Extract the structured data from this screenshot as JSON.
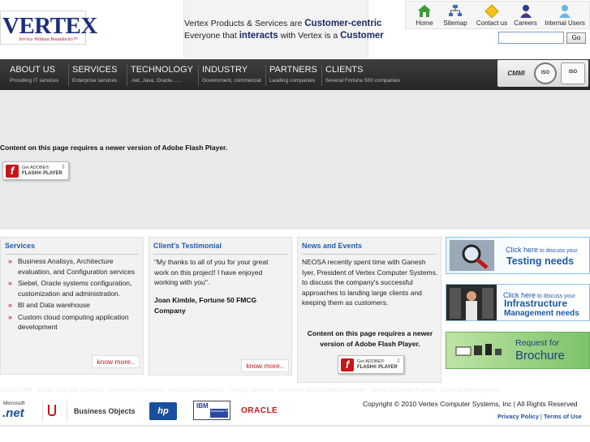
{
  "header": {
    "logo_text": "VERTEX",
    "logo_tagline": "Service Without Boundaries™",
    "banner_line1_pre": "Vertex Products & Services are ",
    "banner_line1_emph": "Customer-centric",
    "banner_line2_pre": "Everyone that ",
    "banner_line2_emph": "interacts",
    "banner_line2_mid": " with Vertex is a ",
    "banner_line2_end": "Customer",
    "topnav": [
      {
        "label": "Home",
        "icon": "home-icon"
      },
      {
        "label": "Sitemap",
        "icon": "sitemap-icon"
      },
      {
        "label": "Contact us",
        "icon": "contact-icon"
      },
      {
        "label": "Careers",
        "icon": "careers-icon"
      },
      {
        "label": "Internal Users",
        "icon": "users-icon"
      }
    ],
    "search_value": "",
    "go_label": "Go"
  },
  "mainnav": [
    {
      "title": "ABOUT US",
      "sub": "Providing IT services"
    },
    {
      "title": "SERVICES",
      "sub": "Enterprise services"
    },
    {
      "title": "TECHNOLOGY",
      "sub": ".net, Java, Oracle......"
    },
    {
      "title": "INDUSTRY",
      "sub": "Government, commercial"
    },
    {
      "title": "PARTNERS",
      "sub": "Leading  companies"
    },
    {
      "title": "CLIENTS",
      "sub": "Several Fortune 500 companies"
    }
  ],
  "certs": {
    "cmmi": "CMMI",
    "iso1": "ISO",
    "iso2": "ISO"
  },
  "flash": {
    "message": "Content on this page requires a newer version of Adobe Flash Player.",
    "badge_get": "Get ADOBE®",
    "badge_fp": "FLASH® PLAYER"
  },
  "services": {
    "title": "Services",
    "items": [
      "Business Analisys, Architecture evaluation, and Configuration services",
      "Siebel, Oracle systems configuration, customization and administration.",
      "BI and Data warehouse",
      "Custom cloud computing application development"
    ],
    "more": "know more.."
  },
  "testimonial": {
    "title": "Client's Testimonial",
    "quote": "\"My thanks to all of you for your great work on this project! I have enjoyed working with you\".",
    "author": "Joan Kimble, Fortune 50 FMCG Company",
    "more": "know more.."
  },
  "news": {
    "title": "News and Events",
    "text": "NEOSA recently spent time with Ganesh Iyer, President of Vertex Computer Systems, to discuss the company's successful approaches to landing large clients and keeping them as customers.",
    "flash_message": "Content on this page requires a newer version of Adobe Flash Player."
  },
  "promos": {
    "testing_small": "Click here",
    "testing_small2": " to discuss your",
    "testing_big": "Testing needs",
    "infra_small": "Click here",
    "infra_small2": " to discuss your",
    "infra_big1": "Infrastructure",
    "infra_big2": "Management needs",
    "brochure_small": "Request for",
    "brochure_big": "Brochure"
  },
  "footer": {
    "links": "Oracle CRM · Siebel Upgrade Services · Sharepoint Services · Verification Services · Testing Services · Microsoft Gold Certified Partner · JBoss Solutions Partner · Content Management",
    "logos": {
      "ms": "Microsoft",
      "net": ".net",
      "bo": "Business Objects",
      "hp": "hp",
      "ibm": "IBM",
      "ibm_bp": "Business Partner",
      "oracle": "ORACLE"
    },
    "copyright": "Copyright © 2010 Vertex Computer Systems, Inc | All Rights Reserved",
    "privacy": "Privacy Policy",
    "terms": "Terms of Use"
  }
}
